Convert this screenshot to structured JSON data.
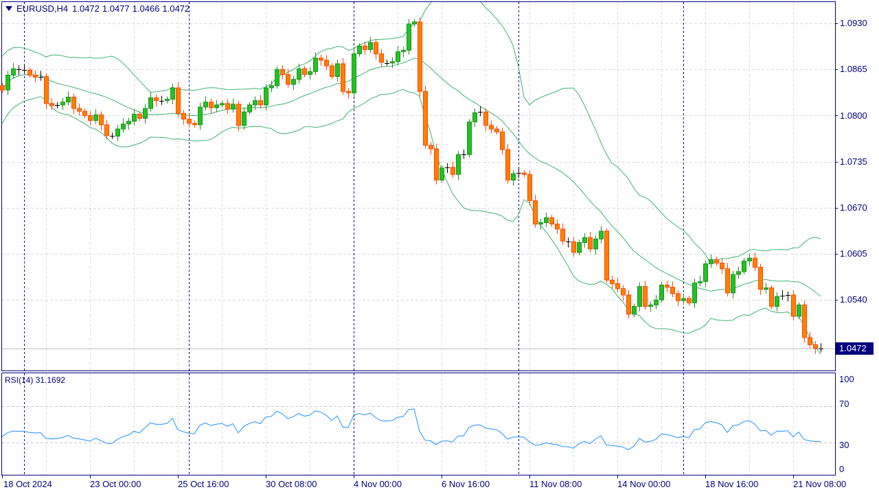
{
  "header": {
    "symbol": "EURUSD,H4",
    "open": "1.0472",
    "high": "1.0477",
    "low": "1.0466",
    "close": "1.0472"
  },
  "current_price_label": "1.0472",
  "price_axis": [
    "1.0930",
    "1.0865",
    "1.0800",
    "1.0735",
    "1.0670",
    "1.0605",
    "1.0540"
  ],
  "rsi": {
    "label": "RSI(14)",
    "value": "31.1692",
    "axis": [
      "100",
      "70",
      "30",
      "0"
    ]
  },
  "time_axis": [
    "18 Oct 2024",
    "23 Oct 00:00",
    "25 Oct 16:00",
    "30 Oct 08:00",
    "4 Nov 00:00",
    "6 Nov 16:00",
    "11 Nov 08:00",
    "14 Nov 00:00",
    "18 Nov 16:00",
    "21 Nov 08:00"
  ],
  "colors": {
    "bull": "#22c322",
    "bull_border": "#1f8f1f",
    "bear": "#ff8000",
    "bear_border": "#ff4500",
    "bands": "#3cb371",
    "rsi": "#1e90ff",
    "axis": "#000080"
  },
  "chart_data": {
    "type": "candlestick",
    "symbol": "EURUSD",
    "timeframe": "H4",
    "ylim": [
      1.0445,
      1.0965
    ],
    "first_open": 1.0842,
    "closes": [
      1.0836,
      1.0857,
      1.0866,
      1.0865,
      1.0864,
      1.0857,
      1.0854,
      1.0855,
      1.0817,
      1.0814,
      1.0815,
      1.0819,
      1.0826,
      1.081,
      1.0806,
      1.08,
      1.0793,
      1.0801,
      1.0787,
      1.0772,
      1.0771,
      1.0781,
      1.0788,
      1.0792,
      1.0802,
      1.0796,
      1.081,
      1.0825,
      1.0821,
      1.0821,
      1.0823,
      1.0839,
      1.0803,
      1.0795,
      1.0789,
      1.0787,
      1.0812,
      1.0819,
      1.0811,
      1.0815,
      1.0817,
      1.0809,
      1.0816,
      1.0786,
      1.0805,
      1.0815,
      1.0821,
      1.0815,
      1.0839,
      1.0842,
      1.0865,
      1.0858,
      1.0844,
      1.0851,
      1.0866,
      1.0858,
      1.0862,
      1.0881,
      1.0878,
      1.087,
      1.0855,
      1.0873,
      1.0834,
      1.0832,
      1.0887,
      1.0898,
      1.0893,
      1.0903,
      1.0887,
      1.0875,
      1.0874,
      1.0876,
      1.089,
      1.0892,
      1.0929,
      1.0932,
      1.0834,
      1.0758,
      1.0753,
      1.0709,
      1.0726,
      1.0727,
      1.0717,
      1.0745,
      1.0745,
      1.0791,
      1.0804,
      1.0805,
      1.0786,
      1.0781,
      1.0777,
      1.0752,
      1.0709,
      1.0718,
      1.0719,
      1.0717,
      1.068,
      1.0647,
      1.0649,
      1.0656,
      1.0647,
      1.064,
      1.0623,
      1.0622,
      1.0607,
      1.0621,
      1.0628,
      1.0612,
      1.0626,
      1.0637,
      1.0568,
      1.0563,
      1.0556,
      1.0547,
      1.052,
      1.0531,
      1.0559,
      1.0531,
      1.0533,
      1.054,
      1.0561,
      1.0558,
      1.0549,
      1.0539,
      1.0542,
      1.0536,
      1.0564,
      1.0566,
      1.0591,
      1.0597,
      1.0592,
      1.0584,
      1.055,
      1.0576,
      1.058,
      1.0595,
      1.0599,
      1.0586,
      1.0555,
      1.0557,
      1.0531,
      1.0545,
      1.0546,
      1.0547,
      1.0517,
      1.0533,
      1.0487,
      1.0477,
      1.0472,
      1.0472
    ],
    "indicators": [
      "Bollinger Bands (20, 2)",
      "RSI(14)"
    ],
    "rsi_levels": [
      70,
      30
    ],
    "rsi_ylim": [
      0,
      100
    ]
  }
}
